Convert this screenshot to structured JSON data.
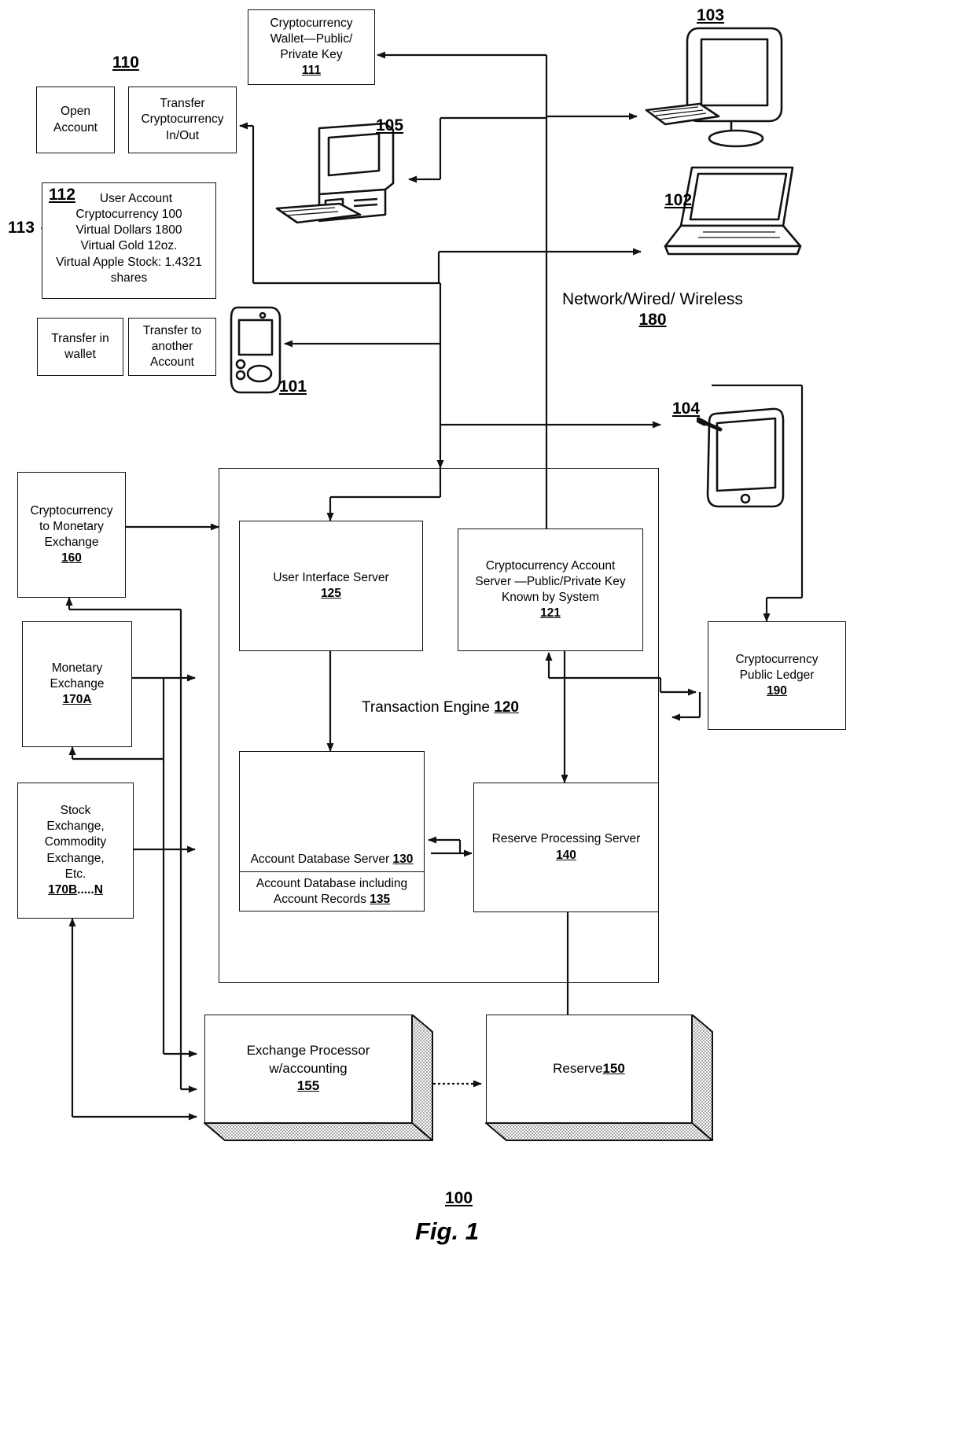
{
  "figure": {
    "caption": "Fig. 1",
    "system_ref": "100"
  },
  "user_portal": {
    "ref": "110",
    "open_account": {
      "label": "Open\nAccount"
    },
    "transfer_crypto": {
      "line1": "Transfer",
      "line2": "Cryptocurrency",
      "line3": "In/Out"
    },
    "user_account": {
      "ref": "112",
      "pointer_ref": "113",
      "title": "User Account",
      "lines": [
        "Cryptocurrency 100",
        "Virtual Dollars 1800",
        "Virtual Gold 12oz.",
        "Virtual Apple Stock: 1.4321",
        "shares"
      ]
    },
    "transfer_in_wallet": {
      "line1": "Transfer in",
      "line2": "wallet"
    },
    "transfer_other_account": {
      "line1": "Transfer to",
      "line2": "another",
      "line3": "Account"
    }
  },
  "wallet": {
    "line1": "Cryptocurrency",
    "line2": "Wallet—Public/",
    "line3": "Private Key",
    "ref": "111"
  },
  "devices": {
    "desktop_center": {
      "ref": "105",
      "icon": "desktop-computer-icon"
    },
    "monitor": {
      "ref": "103",
      "icon": "monitor-keyboard-icon"
    },
    "laptop": {
      "ref": "102",
      "icon": "laptop-icon"
    },
    "phone": {
      "ref": "101",
      "icon": "mobile-phone-icon"
    },
    "tablet": {
      "ref": "104",
      "icon": "tablet-stylus-icon"
    }
  },
  "network": {
    "line1": "Network/Wired/",
    "line2": "Wireless",
    "ref": "180"
  },
  "transaction_engine": {
    "title": "Transaction Engine",
    "ref": "120",
    "user_interface_server": {
      "title": "User Interface Server",
      "ref": "125"
    },
    "crypto_account_server": {
      "line1": "Cryptocurrency Account",
      "line2": "Server —Public/Private Key",
      "line3": "Known by System",
      "ref": "121"
    },
    "account_database_server": {
      "title": "Account Database Server",
      "ref": "130",
      "inner_line1": "Account Database including",
      "inner_line2": "Account Records",
      "inner_ref": "135"
    },
    "reserve_processing_server": {
      "title": "Reserve Processing Server",
      "ref": "140"
    }
  },
  "exchanges": {
    "crypto_to_monetary": {
      "line1": "Cryptocurrency",
      "line2": "to Monetary",
      "line3": "Exchange",
      "ref": "160"
    },
    "monetary_exchange": {
      "line1": "Monetary",
      "line2": "Exchange",
      "ref": "170A"
    },
    "stock_commodity": {
      "line1": "Stock",
      "line2": "Exchange,",
      "line3": "Commodity",
      "line4": "Exchange,",
      "line5": "Etc.",
      "ref_a": "170B",
      "ref_dots": ".....",
      "ref_b": "N"
    }
  },
  "public_ledger": {
    "line1": "Cryptocurrency",
    "line2": "Public Ledger",
    "ref": "190"
  },
  "processing": {
    "exchange_processor": {
      "line1": "Exchange Processor",
      "line2": "w/accounting",
      "ref": "155"
    },
    "reserve": {
      "label": "Reserve ",
      "ref": "150"
    }
  },
  "colors": {
    "line": "#111111",
    "background": "#ffffff",
    "shade": "#d8d8d8"
  }
}
